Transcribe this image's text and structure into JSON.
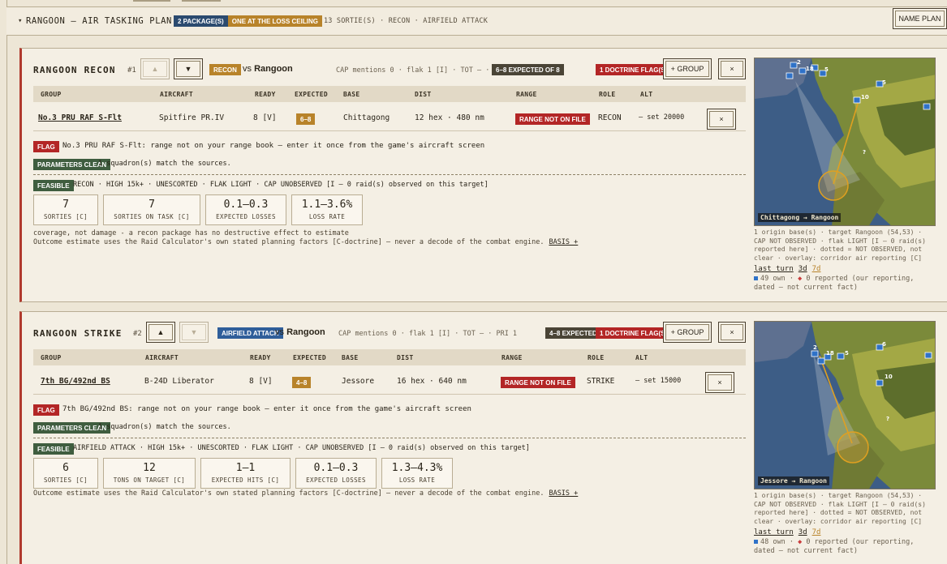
{
  "plan": {
    "title": "RANGOON — AIR TASKING PLAN",
    "caret": "▾",
    "badge_packages": "2 PACKAGE(S)",
    "badge_ceiling": "ONE AT THE LOSS CEILING",
    "meta": "13 SORTIE(S) · RECON · AIRFIELD ATTACK",
    "name_plan_label": "NAME PLAN"
  },
  "columns": {
    "group": "GROUP",
    "aircraft": "AIRCRAFT",
    "ready": "READY",
    "expected": "EXPECTED",
    "base": "BASE",
    "dist": "DIST",
    "range": "RANGE",
    "role": "ROLE",
    "alt": "ALT"
  },
  "common": {
    "vs": "vs",
    "target": "Rangoon",
    "group_btn": "+ GROUP",
    "close": "×",
    "up": "▲",
    "down": "▼",
    "flag": "FLAG",
    "params_clean": "PARAMETERS CLEAN",
    "feasible": "FEASIBLE",
    "range_not_on_file": "RANGE NOT ON FILE",
    "doctrine_flags": "1 DOCTRINE FLAG(S)",
    "match_note": "1 squadron(s) match the sources.",
    "outcome_note": "Outcome estimate uses the Raid Calculator's own stated planning factors [C-doctrine] — never a decode of the combat engine.",
    "basis": "BASIS +",
    "turn_last": "last turn",
    "turn_3d": "3d",
    "turn_7d": "7d",
    "reported": "0 reported (our reporting, dated — not current fact)"
  },
  "packages": [
    {
      "name": "RANGOON RECON",
      "num": "#1",
      "mission": "RECON",
      "meta": "CAP mentions 0 · flak 1 [I] · TOT — · PRI 1",
      "expected_badge": "6–8 EXPECTED OF 8",
      "row": {
        "group": "No.3 PRU RAF S-Flt",
        "aircraft": "Spitfire PR.IV",
        "ready": "8 [V]",
        "expected": "6–8",
        "base": "Chittagong",
        "dist": "12 hex · 480 nm",
        "role": "RECON",
        "alt": "— set 20000"
      },
      "flag_text": "No.3 PRU RAF S-Flt: range not on your range book — enter it once from the game's aircraft screen",
      "feasible_text": "RECON · HIGH 15k+ · UNESCORTED · FLAK LIGHT · CAP UNOBSERVED [I — 0 raid(s) observed on this target]",
      "stats": [
        {
          "value": "7",
          "label": "SORTIES [C]"
        },
        {
          "value": "7",
          "label": "SORTIES ON TASK [C]"
        },
        {
          "value": "0.1–0.3",
          "label": "EXPECTED LOSSES"
        },
        {
          "value": "1.1–3.6%",
          "label": "LOSS RATE"
        }
      ],
      "coverage_note": "coverage, not damage - a recon package has no destructive effect to estimate",
      "map_caption": "Chittagong → Rangoon",
      "map_note": "1 origin base(s) · target Rangoon (54,53) · CAP NOT OBSERVED · flak LIGHT [I — 0 raid(s) reported here] · dotted = NOT OBSERVED, not clear · overlay: corridor air reporting [C]",
      "own_count": "49 own"
    },
    {
      "name": "RANGOON STRIKE",
      "num": "#2",
      "mission": "AIRFIELD ATTACK",
      "meta": "CAP mentions 0 · flak 1 [I] · TOT — · PRI 1",
      "expected_badge": "4–8 EXPECTED OF 8",
      "row": {
        "group": "7th BG/492nd BS",
        "aircraft": "B-24D Liberator",
        "ready": "8 [V]",
        "expected": "4–8",
        "base": "Jessore",
        "dist": "16 hex · 640 nm",
        "role": "STRIKE",
        "alt": "— set 15000"
      },
      "flag_text": "7th BG/492nd BS: range not on your range book — enter it once from the game's aircraft screen",
      "feasible_text": "AIRFIELD ATTACK · HIGH 15k+ · UNESCORTED · FLAK LIGHT · CAP UNOBSERVED [I — 0 raid(s) observed on this target]",
      "stats": [
        {
          "value": "6",
          "label": "SORTIES [C]"
        },
        {
          "value": "12",
          "label": "TONS ON TARGET [C]"
        },
        {
          "value": "1–1",
          "label": "EXPECTED HITS [C]"
        },
        {
          "value": "0.1–0.3",
          "label": "EXPECTED LOSSES"
        },
        {
          "value": "1.3–4.3%",
          "label": "LOSS RATE"
        }
      ],
      "map_caption": "Jessore → Rangoon",
      "map_note": "1 origin base(s) · target Rangoon (54,53) · CAP NOT OBSERVED · flak LIGHT [I — 0 raid(s) reported here] · dotted = NOT OBSERVED, not clear · overlay: corridor air reporting [C]",
      "own_count": "48 own"
    }
  ],
  "colors": {
    "accent_red": "#b03a2e",
    "gold": "#b8832a",
    "navy": "#2b4a6f",
    "green": "#3f5d3f"
  }
}
